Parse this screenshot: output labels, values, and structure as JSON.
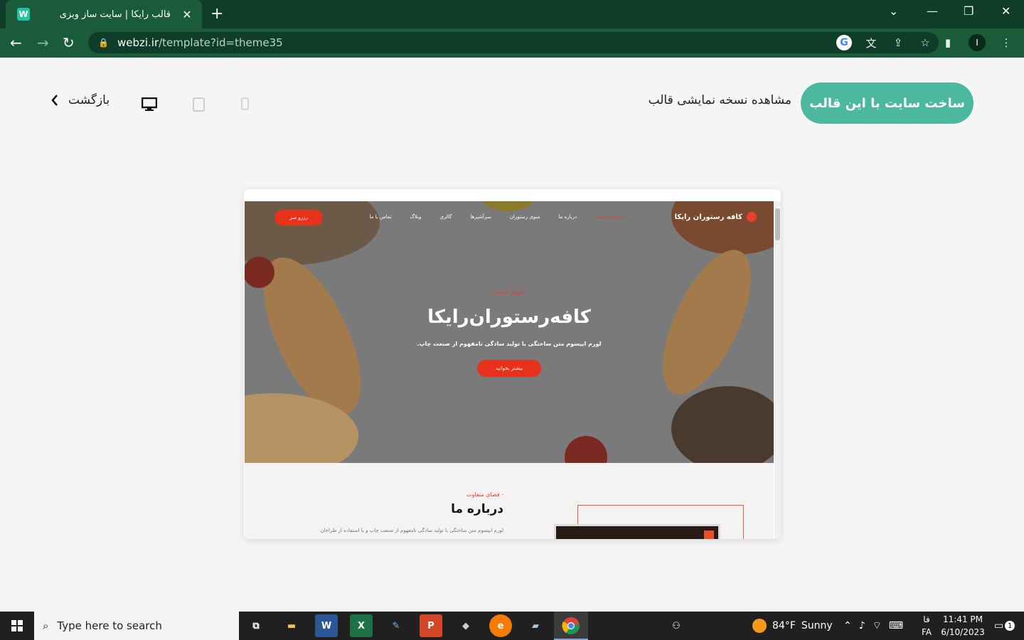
{
  "browser": {
    "tab_title": "قالب رایکا | سایت ساز وبزی",
    "tab_close": "✕",
    "new_tab": "+",
    "url_host": "webzi.ir",
    "url_path": "/template?id=theme35",
    "profile_initial": "I"
  },
  "page": {
    "build_button": "ساخت سایت با این قالب",
    "demo_label": "مشاهده نسخه نمایشی قالب",
    "back_label": "بازگشت",
    "devices": [
      "desktop-icon",
      "tablet-icon",
      "mobile-icon"
    ],
    "accent_color": "#4db8a0"
  },
  "preview": {
    "site_name": "کافه رستوران رایکا",
    "menu": [
      "صفحه نخست",
      "درباره ما",
      "منوی رستوران",
      "سرآشپزها",
      "گالری",
      "وبلاگ",
      "تماس با ما"
    ],
    "reserve_button": "رزرو میز",
    "hero_subtitle": "- خوش آمدید -",
    "hero_title": "کافه‌رستوران‌رایکا",
    "hero_desc": "لورم ایپسوم متن ساختگی با تولید سادگی نامفهوم از صنعت چاپ.",
    "hero_button": "بیشتر بخوانید",
    "about_kicker": "- فضای متفاوت",
    "about_title": "درباره ما",
    "about_text": "لورم ایپسوم متن ساختگی با تولید سادگی نامفهوم از صنعت چاپ و با استفاده از طراحان",
    "brand_color": "#e8311a"
  },
  "taskbar": {
    "search_placeholder": "Type here to search",
    "weather_temp": "84°F",
    "weather_desc": "Sunny",
    "lang_top": "فا",
    "lang_bottom": "FA",
    "time": "11:41 PM",
    "date": "6/10/2023",
    "notif_count": "1"
  }
}
